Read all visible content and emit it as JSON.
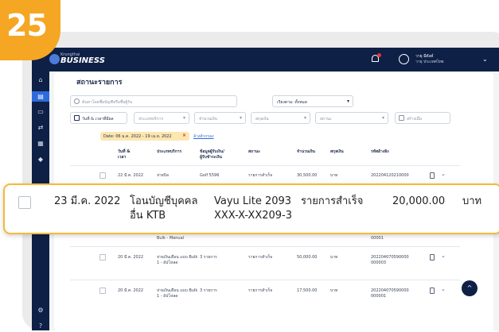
{
  "step_badge": "25",
  "topbar": {
    "logo_small": "Krungthai",
    "logo_big": "BUSINESS",
    "user_name": "วายุ มีตังค์",
    "user_company": "วายุ ประเทศไทย"
  },
  "page": {
    "title": "สถานะรายการ"
  },
  "filters": {
    "search_placeholder": "ค้นหาโดยชื่อบัญชีหรือชื่อผู้รับ",
    "sort_label": "เรียงตาม: ทั้งหมด",
    "date_filter": "วันที่ & เวลาที่มีผล",
    "service_placeholder": "ประเภทบริการ",
    "amount_placeholder": "จำนวนเงิน",
    "currency_placeholder": "สกุลเงิน",
    "status_placeholder": "สถานะ",
    "created_placeholder": "สร้างเมื่อ"
  },
  "chip": {
    "text": "Date: 06 ม.ค. 2022 - 19 เม.ย. 2022"
  },
  "reset_link": "ล้างตัวกรอง",
  "table": {
    "headers": {
      "date_l1": "วันที่ &",
      "date_l2": "เวลา",
      "type": "ประเภทบริการ",
      "payee_l1": "ข้อมูลผู้รับเงิน/",
      "payee_l2": "ผู้รับชำระเงิน",
      "status": "สถานะ",
      "amount": "จำนวนเงิน",
      "currency": "สกุลเงิน",
      "ref": "รหัสอ้างอิง"
    },
    "rows": [
      {
        "date": "22 มี.ค. 2022",
        "type": "จ่ายบิล",
        "payee_l1": "Golf 5596",
        "payee_l2": "",
        "status": "รายการสำเร็จ",
        "amount": "30,500.00",
        "currency": "บาท",
        "ref_l1": "202204120210000",
        "ref_l2": ""
      },
      {
        "date": "",
        "type": "Bulk - Manual",
        "payee_l1": "",
        "payee_l2": "",
        "status": "",
        "amount": "",
        "currency": "",
        "ref_l1": "00001",
        "ref_l2": ""
      },
      {
        "date": "20 มี.ค. 2022",
        "type": "จ่ายเงินเดือน แบบ Bulk 1 - อัปโหลด",
        "payee_l1": "3 รายการ",
        "payee_l2": "",
        "status": "รายการสำเร็จ",
        "amount": "50,000.00",
        "currency": "บาท",
        "ref_l1": "202204070590000",
        "ref_l2": "000003"
      },
      {
        "date": "20 มี.ค. 2022",
        "type": "จ่ายเงินเดือน แบบ Bulk 1 - อัปโหลด",
        "payee_l1": "3 รายการ",
        "payee_l2": "",
        "status": "รายการสำเร็จ",
        "amount": "17,500.00",
        "currency": "บาท",
        "ref_l1": "202204070590000",
        "ref_l2": "000001"
      }
    ]
  },
  "zoom_row": {
    "date": "23 มี.ค. 2022",
    "type_l1": "โอนบัญชีบุคคล",
    "type_l2": "อื่น KTB",
    "payee_l1": "Vayu Lite 2093",
    "payee_l2": "XXX-X-XX209-3",
    "status": "รายการสำเร็จ",
    "amount": "20,000.00",
    "currency": "บาท"
  },
  "colors": {
    "navy": "#0e2046",
    "accent_blue": "#2d6bdc",
    "badge_orange": "#f5a623",
    "chip_yellow": "#fde7b0",
    "zoom_border": "#f5b93a"
  }
}
